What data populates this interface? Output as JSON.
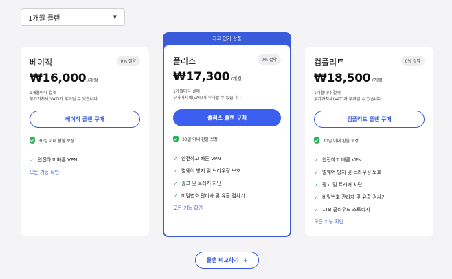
{
  "plan_select": {
    "value": "1개월 플랜"
  },
  "plans": [
    {
      "name": "베이직",
      "badge": "0% 절약",
      "price": "₩16,000",
      "per": "/개월",
      "billing": "1개월마다 결제",
      "vat": "부가가치세(VAT)가 부과될 수 있습니다",
      "button": "베이직 플랜 구매",
      "refund": "30일 이내 환불 보장",
      "features": [
        "안전하고 빠른 VPN"
      ],
      "all_features": "모든 기능 확인"
    },
    {
      "ribbon": "최고 인기 상품",
      "name": "플러스",
      "badge": "0% 절약",
      "price": "₩17,300",
      "per": "/개월",
      "billing": "1개월마다 결제",
      "vat": "부가가치세(VAT)가 부과될 수 있습니다",
      "button": "플러스 플랜 구매",
      "refund": "30일 이내 환불 보장",
      "features": [
        "안전하고 빠른 VPN",
        "멀웨어 방지 및 브라우징 보호",
        "광고 및 트래커 차단",
        "비밀번호 관리자 및 유출 검사기"
      ],
      "all_features": "모든 기능 확인"
    },
    {
      "name": "컴플리트",
      "badge": "0% 절약",
      "price": "₩18,500",
      "per": "/개월",
      "billing": "1개월마다 결제",
      "vat": "부가가치세(VAT)가 부과될 수 있습니다",
      "button": "컴플리트 플랜 구매",
      "refund": "30일 이내 환불 보장",
      "features": [
        "안전하고 빠른 VPN",
        "멀웨어 방지 및 브라우징 보호",
        "광고 및 트래커 차단",
        "비밀번호 관리자 및 유출 검사기",
        "1TB 클라우드 스토리지"
      ],
      "all_features": "모든 기능 확인"
    }
  ],
  "compare_button": "플랜 비교하기",
  "colors": {
    "accent": "#3a5bd9",
    "check": "#2a9d4f",
    "shield": "#2bb05a"
  },
  "icons": {
    "dropdown": "chevron-down-icon",
    "check": "check-icon",
    "refund": "shield-icon",
    "compare": "arrow-down-icon"
  }
}
